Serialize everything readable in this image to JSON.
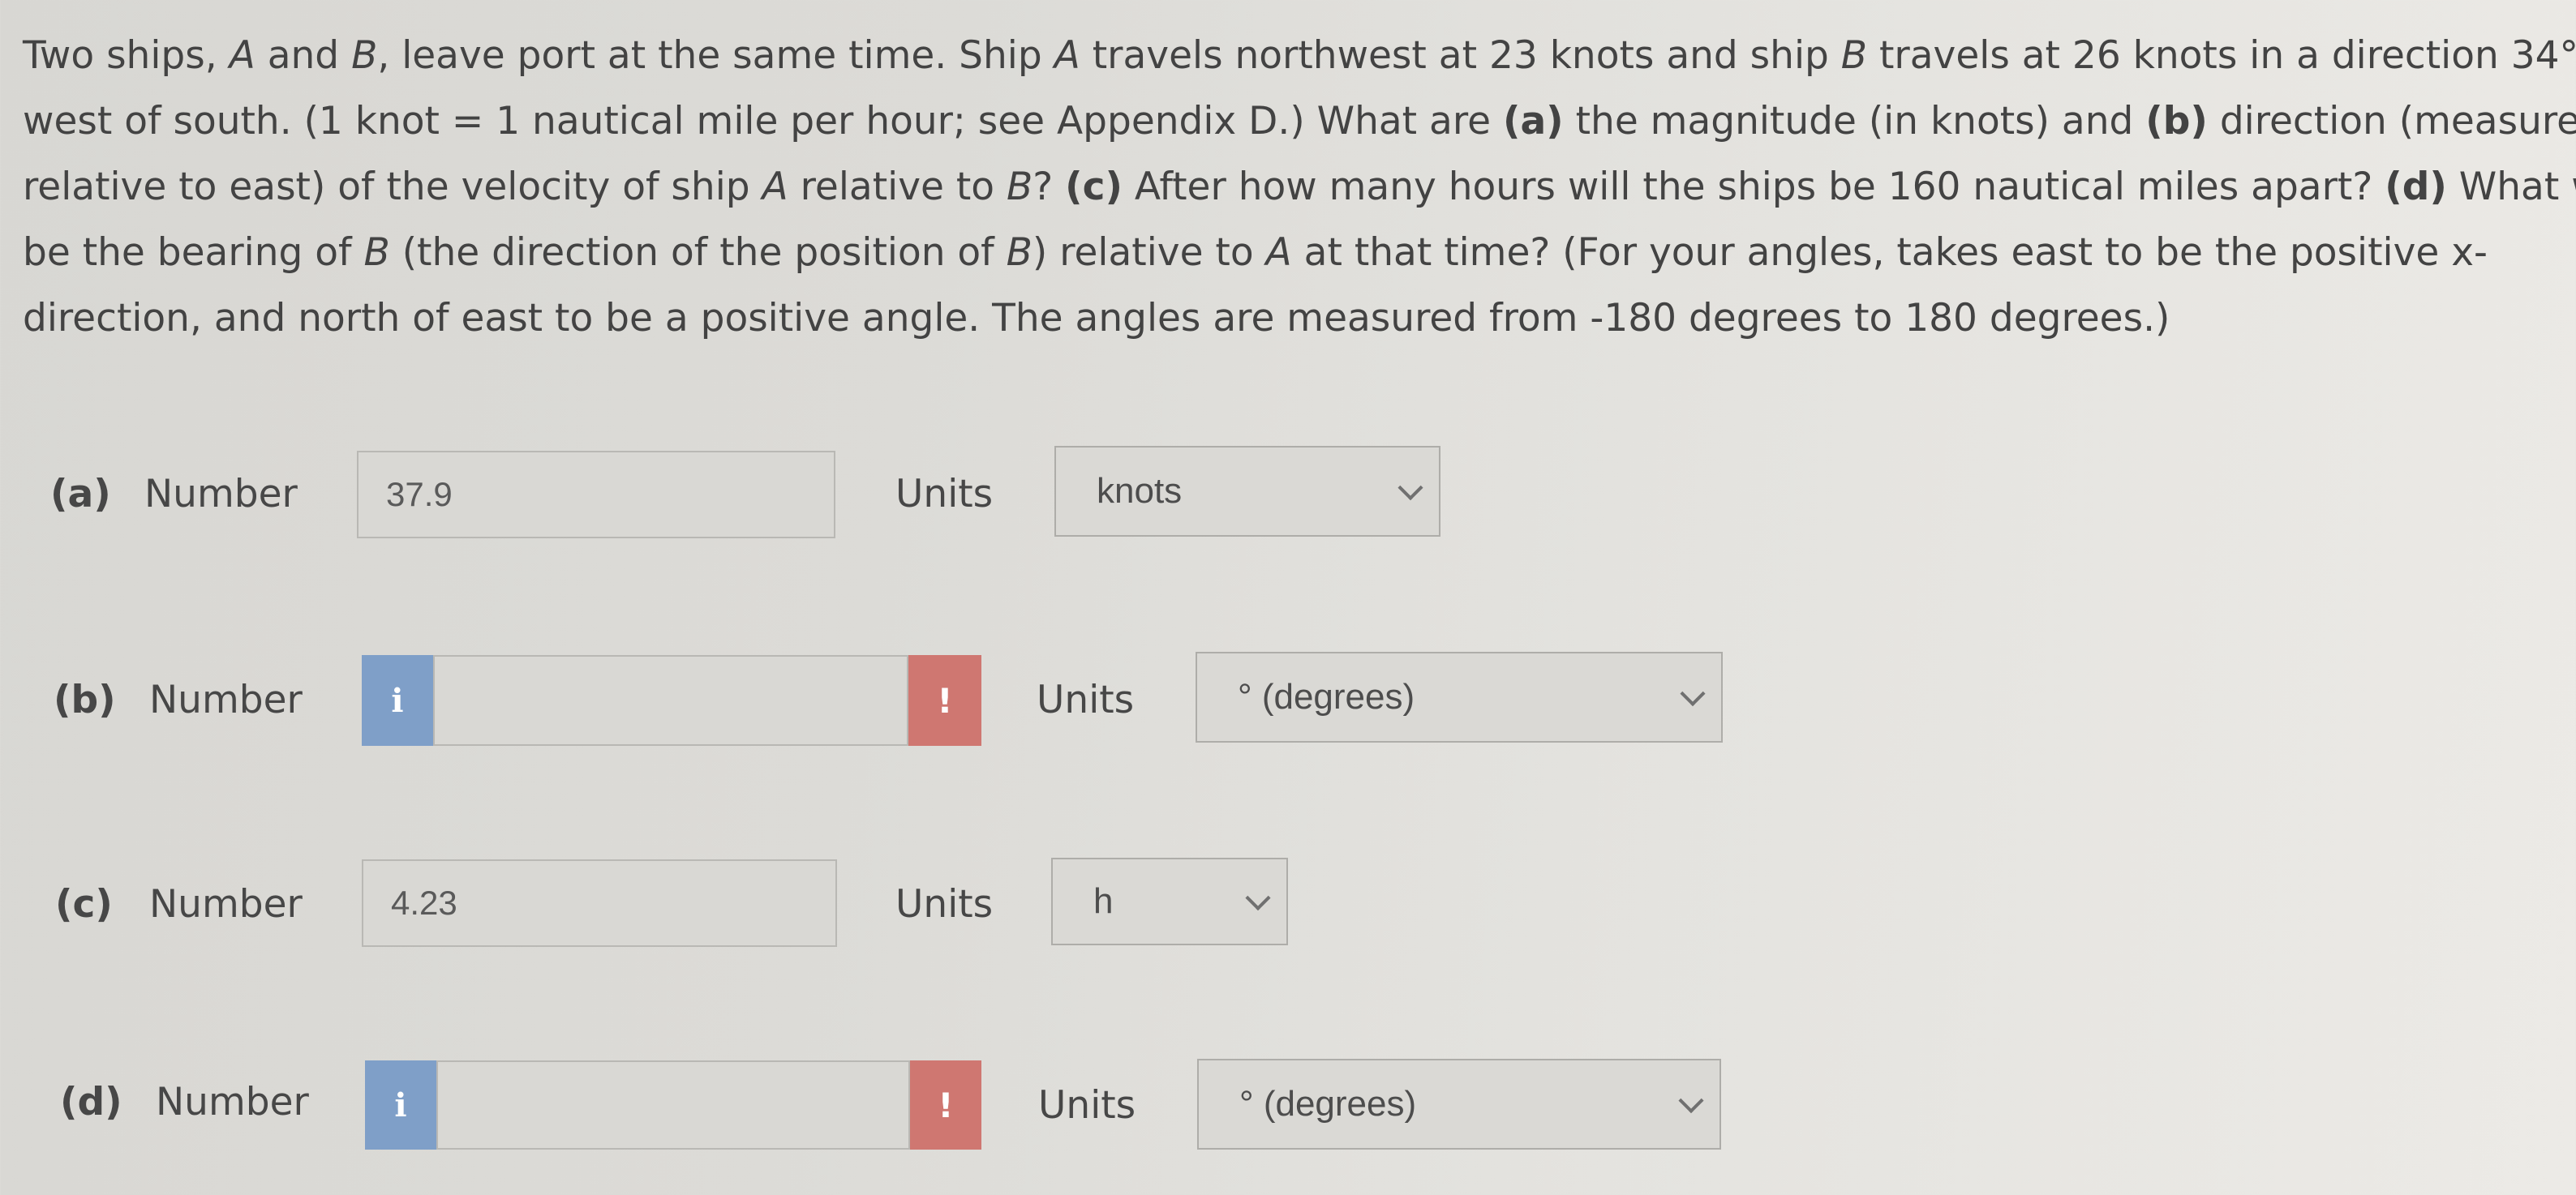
{
  "question": {
    "line1_a": "Two ships, ",
    "line1_b": "A",
    "line1_c": " and ",
    "line1_d": "B",
    "line1_e": ", leave port at the same time. Ship ",
    "line1_f": "A",
    "line1_g": " travels northwest at 23 knots and ship ",
    "line1_h": "B",
    "line1_i": " travels at 26 knots in a direction 34°",
    "line2_a": "west of south. (1 knot = 1 nautical mile per hour; see Appendix D.) What are ",
    "line2_b": "(a)",
    "line2_c": " the magnitude (in knots) and ",
    "line2_d": "(b)",
    "line2_e": " direction (measured",
    "line3_a": "relative to east) of the velocity of ship ",
    "line3_b": "A",
    "line3_c": " relative to ",
    "line3_d": "B",
    "line3_e": "? ",
    "line3_f": "(c)",
    "line3_g": " After how many hours will the ships be 160 nautical miles apart? ",
    "line3_h": "(d)",
    "line3_i": " What wil",
    "line4_a": "be the bearing of ",
    "line4_b": "B",
    "line4_c": " (the direction of the position of ",
    "line4_d": "B",
    "line4_e": ") relative to ",
    "line4_f": "A",
    "line4_g": " at that time? (For your angles, takes east to be the positive x-",
    "line5": "direction, and north of east to be a positive angle. The angles are measured from -180 degrees to 180 degrees.)"
  },
  "parts": [
    {
      "label": "(a)",
      "number_label": "Number",
      "value": "37.9",
      "units_label": "Units",
      "unit": "knots",
      "has_info": false,
      "has_warning": false
    },
    {
      "label": "(b)",
      "number_label": "Number",
      "value": "",
      "units_label": "Units",
      "unit": "° (degrees)",
      "has_info": true,
      "has_warning": true,
      "info_icon": "i",
      "warning_icon": "!"
    },
    {
      "label": "(c)",
      "number_label": "Number",
      "value": "4.23",
      "units_label": "Units",
      "unit": "h",
      "has_info": false,
      "has_warning": false
    },
    {
      "label": "(d)",
      "number_label": "Number",
      "value": "",
      "units_label": "Units",
      "unit": "° (degrees)",
      "has_info": true,
      "has_warning": true,
      "info_icon": "i",
      "warning_icon": "!"
    }
  ],
  "icons": {
    "info": "info-icon",
    "warning": "warning-icon",
    "dropdown": "chevron-down-icon"
  },
  "colors": {
    "info": "#7f9fc8",
    "warning": "#cf7771"
  }
}
